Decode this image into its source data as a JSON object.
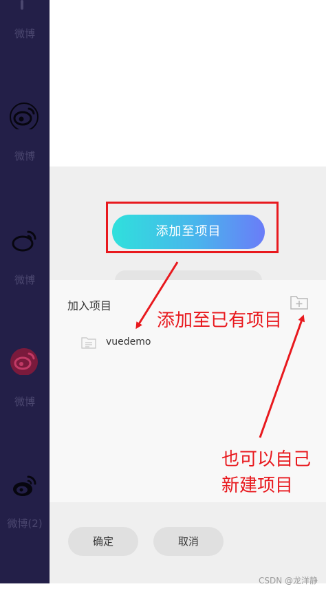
{
  "sidebar": {
    "items": [
      {
        "label": "微博",
        "icon": "weibo-icon"
      },
      {
        "label": "微博",
        "icon": "weibo-icon"
      },
      {
        "label": "微博",
        "icon": "weibo-outline-icon"
      },
      {
        "label": "微博",
        "icon": "weibo-icon"
      },
      {
        "label": "微博(2)",
        "icon": "weibo-icon"
      }
    ]
  },
  "main": {
    "add_button_label": "添加至项目"
  },
  "sheet": {
    "title": "加入项目",
    "projects": [
      {
        "name": "vuedemo"
      }
    ]
  },
  "footer": {
    "confirm_label": "确定",
    "cancel_label": "取消"
  },
  "annotations": {
    "add_existing": "添加至已有项目",
    "create_line1": "也可以自己",
    "create_line2": "新建项目"
  },
  "watermark": "CSDN @龙洋静",
  "colors": {
    "sidebar_bg": "#231f48",
    "annotation_red": "#e8191e",
    "gradient_start": "#2fe0dc",
    "gradient_end": "#6a7cf8"
  }
}
